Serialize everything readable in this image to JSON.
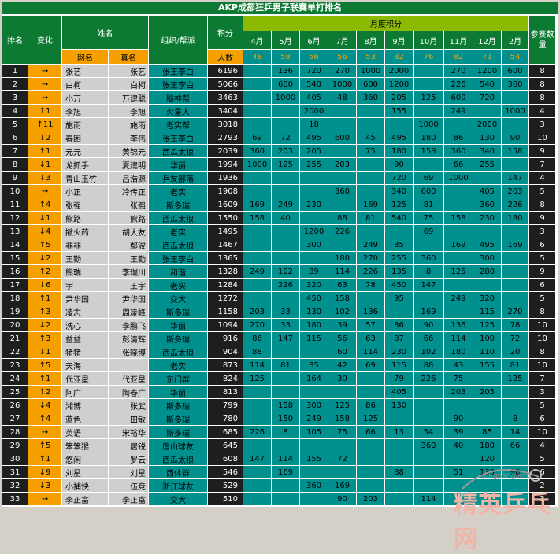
{
  "title": "AKP成都狂乒男子联赛单打排名",
  "headers": {
    "rank": "排名",
    "change": "变化",
    "name": "姓名",
    "nick": "网名",
    "real": "真名",
    "club": "组织/帮派",
    "score": "积分",
    "people": "人数",
    "monthly": "月度积分",
    "entries": "参赛数量"
  },
  "months": [
    "4月",
    "5月",
    "6月",
    "7月",
    "8月",
    "9月",
    "10月",
    "11月",
    "12月",
    "2月"
  ],
  "month_counts": [
    "48",
    "58",
    "56",
    "56",
    "53",
    "82",
    "76",
    "82",
    "71",
    "54"
  ],
  "rows": [
    {
      "rank": "1",
      "change": "→",
      "nick": "张艺",
      "real": "张艺",
      "club": "张王李白",
      "score": "6196",
      "m": [
        "",
        "136",
        "720",
        "270",
        "1000",
        "2000",
        "",
        "270",
        "1200",
        "600"
      ],
      "entries": "8"
    },
    {
      "rank": "2",
      "change": "→",
      "nick": "白柯",
      "real": "白柯",
      "club": "张王李白",
      "score": "5066",
      "m": [
        "",
        "600",
        "540",
        "1000",
        "600",
        "1200",
        "",
        "226",
        "540",
        "360"
      ],
      "entries": "8"
    },
    {
      "rank": "3",
      "change": "→",
      "nick": "小万",
      "real": "万建聪",
      "club": "脑神帮",
      "score": "3463",
      "m": [
        "",
        "1000",
        "405",
        "48",
        "360",
        "205",
        "125",
        "600",
        "720",
        ""
      ],
      "entries": "8"
    },
    {
      "rank": "4",
      "change": "↑1",
      "nick": "李旭",
      "real": "李旭",
      "club": "火星人",
      "score": "3404",
      "m": [
        "",
        "",
        "2000",
        "",
        "",
        "155",
        "",
        "249",
        "",
        "1000"
      ],
      "entries": "4"
    },
    {
      "rank": "5",
      "change": "↑11",
      "nick": "施雨",
      "real": "施雨",
      "club": "老实帮",
      "score": "3018",
      "m": [
        "",
        "",
        "18",
        "",
        "",
        "",
        "1000",
        "",
        "2000",
        ""
      ],
      "entries": "3"
    },
    {
      "rank": "6",
      "change": "↓2",
      "nick": "春困",
      "real": "李伟",
      "club": "张王李白",
      "score": "2793",
      "m": [
        "69",
        "72",
        "495",
        "600",
        "45",
        "495",
        "180",
        "86",
        "130",
        "90"
      ],
      "entries": "10"
    },
    {
      "rank": "7",
      "change": "↑1",
      "nick": "元元",
      "real": "黄锦元",
      "club": "西瓜太狼",
      "score": "2039",
      "m": [
        "360",
        "203",
        "205",
        "",
        "75",
        "180",
        "158",
        "360",
        "340",
        "158"
      ],
      "entries": "9"
    },
    {
      "rank": "8",
      "change": "↓1",
      "nick": "龙抓手",
      "real": "夏建明",
      "club": "华丽",
      "score": "1994",
      "m": [
        "1000",
        "125",
        "255",
        "203",
        "",
        "90",
        "",
        "66",
        "255",
        ""
      ],
      "entries": "7"
    },
    {
      "rank": "9",
      "change": "↓3",
      "nick": "青山玉竹",
      "real": "吕浩源",
      "club": "乒友部落",
      "score": "1936",
      "m": [
        "",
        "",
        "",
        "",
        "",
        "720",
        "69",
        "1000",
        "",
        "147"
      ],
      "entries": "4"
    },
    {
      "rank": "10",
      "change": "→",
      "nick": "小正",
      "real": "冷传正",
      "club": "老实",
      "score": "1908",
      "m": [
        "",
        "",
        "",
        "360",
        "",
        "340",
        "600",
        "",
        "405",
        "203"
      ],
      "entries": "5"
    },
    {
      "rank": "11",
      "change": "↑4",
      "nick": "张强",
      "real": "张强",
      "club": "斯多瑞",
      "score": "1609",
      "m": [
        "169",
        "249",
        "230",
        "",
        "169",
        "125",
        "81",
        "",
        "360",
        "226"
      ],
      "entries": "8"
    },
    {
      "rank": "12",
      "change": "↓1",
      "nick": "熊路",
      "real": "熊路",
      "club": "西瓜太狼",
      "score": "1550",
      "m": [
        "158",
        "40",
        "",
        "88",
        "81",
        "540",
        "75",
        "158",
        "230",
        "180"
      ],
      "entries": "9"
    },
    {
      "rank": "13",
      "change": "↓4",
      "nick": "撇火药",
      "real": "胡大友",
      "club": "老实",
      "score": "1495",
      "m": [
        "",
        "",
        "1200",
        "226",
        "",
        "",
        "69",
        "",
        "",
        ""
      ],
      "entries": "3"
    },
    {
      "rank": "14",
      "change": "↑5",
      "nick": "非非",
      "real": "鄢波",
      "club": "西瓜太狼",
      "score": "1467",
      "m": [
        "",
        "",
        "300",
        "",
        "249",
        "85",
        "",
        "169",
        "495",
        "169"
      ],
      "entries": "6"
    },
    {
      "rank": "15",
      "change": "↓2",
      "nick": "王勤",
      "real": "王勤",
      "club": "张王李白",
      "score": "1365",
      "m": [
        "",
        "",
        "",
        "180",
        "270",
        "255",
        "360",
        "",
        "300",
        ""
      ],
      "entries": "5"
    },
    {
      "rank": "16",
      "change": "↑2",
      "nick": "熊瑞",
      "real": "李瑞川",
      "club": "和谐",
      "score": "1328",
      "m": [
        "249",
        "102",
        "89",
        "114",
        "226",
        "135",
        "8",
        "125",
        "280",
        ""
      ],
      "entries": "9"
    },
    {
      "rank": "17",
      "change": "↓6",
      "nick": "宇",
      "real": "王宇",
      "club": "老实",
      "score": "1284",
      "m": [
        "",
        "226",
        "320",
        "63",
        "78",
        "450",
        "147",
        "",
        "",
        ""
      ],
      "entries": "6"
    },
    {
      "rank": "18",
      "change": "↑1",
      "nick": "尹华国",
      "real": "尹华国",
      "club": "交大",
      "score": "1272",
      "m": [
        "",
        "",
        "450",
        "158",
        "",
        "95",
        "",
        "249",
        "320",
        ""
      ],
      "entries": "5"
    },
    {
      "rank": "19",
      "change": "↑3",
      "nick": "凌志",
      "real": "周凌峰",
      "club": "斯多瑞",
      "score": "1158",
      "m": [
        "203",
        "33",
        "130",
        "102",
        "136",
        "",
        "169",
        "",
        "115",
        "270"
      ],
      "entries": "8"
    },
    {
      "rank": "20",
      "change": "↓2",
      "nick": "洗心",
      "real": "李鹏飞",
      "club": "华丽",
      "score": "1094",
      "m": [
        "270",
        "33",
        "180",
        "39",
        "57",
        "86",
        "90",
        "136",
        "125",
        "78"
      ],
      "entries": "10"
    },
    {
      "rank": "21",
      "change": "↑3",
      "nick": "益益",
      "real": "彭清辉",
      "club": "斯多瑞",
      "score": "916",
      "m": [
        "86",
        "147",
        "115",
        "56",
        "63",
        "87",
        "66",
        "114",
        "100",
        "72"
      ],
      "entries": "10"
    },
    {
      "rank": "22",
      "change": "↓1",
      "nick": "猪猪",
      "real": "张晓博",
      "club": "西瓜太狼",
      "score": "904",
      "m": [
        "88",
        "",
        "",
        "60",
        "114",
        "230",
        "102",
        "180",
        "110",
        "20"
      ],
      "entries": "8"
    },
    {
      "rank": "23",
      "change": "↑5",
      "nick": "天海",
      "real": "",
      "club": "老实",
      "score": "873",
      "m": [
        "114",
        "81",
        "85",
        "42",
        "69",
        "115",
        "88",
        "43",
        "155",
        "81"
      ],
      "entries": "10"
    },
    {
      "rank": "24",
      "change": "↑1",
      "nick": "代亚星",
      "real": "代亚星",
      "club": "东门群",
      "score": "824",
      "m": [
        "125",
        "",
        "164",
        "30",
        "",
        "79",
        "226",
        "75",
        "",
        "125"
      ],
      "entries": "7"
    },
    {
      "rank": "25",
      "change": "↑2",
      "nick": "阿广",
      "real": "陶春广",
      "club": "华丽",
      "score": "813",
      "m": [
        "",
        "",
        "",
        "",
        "",
        "405",
        "",
        "203",
        "205",
        ""
      ],
      "entries": "3"
    },
    {
      "rank": "26",
      "change": "↓4",
      "nick": "湘博",
      "real": "张武",
      "club": "斯多瑞",
      "score": "799",
      "m": [
        "",
        "158",
        "300",
        "125",
        "86",
        "130",
        "",
        "",
        "",
        ""
      ],
      "entries": "5"
    },
    {
      "rank": "27",
      "change": "↑4",
      "nick": "蓝色",
      "real": "田敏",
      "club": "斯多瑞",
      "score": "780",
      "m": [
        "",
        "150",
        "249",
        "158",
        "125",
        "",
        "",
        "90",
        "",
        "8"
      ],
      "entries": "6"
    },
    {
      "rank": "28",
      "change": "→",
      "nick": "英语",
      "real": "宋裕华",
      "club": "斯多瑞",
      "score": "685",
      "m": [
        "226",
        "8",
        "105",
        "75",
        "66",
        "13",
        "54",
        "39",
        "85",
        "14"
      ],
      "entries": "10"
    },
    {
      "rank": "29",
      "change": "↑5",
      "nick": "笨笨猴",
      "real": "居锐",
      "club": "眉山球友",
      "score": "645",
      "m": [
        "",
        "",
        "",
        "",
        "",
        "",
        "360",
        "40",
        "180",
        "66"
      ],
      "entries": "4"
    },
    {
      "rank": "30",
      "change": "↑1",
      "nick": "悠闲",
      "real": "罗云",
      "club": "西瓜太狼",
      "score": "608",
      "m": [
        "147",
        "114",
        "155",
        "72",
        "",
        "",
        "",
        "",
        "120",
        ""
      ],
      "entries": "5"
    },
    {
      "rank": "31",
      "change": "↓9",
      "nick": "刘星",
      "real": "刘星",
      "club": "西体群",
      "score": "546",
      "m": [
        "",
        "169",
        "",
        "",
        "",
        "88",
        "",
        "51",
        "130",
        "90"
      ],
      "entries": "6"
    },
    {
      "rank": "32",
      "change": "↓3",
      "nick": "小捕快",
      "real": "伍竞",
      "club": "浙江球友",
      "score": "529",
      "m": [
        "",
        "",
        "360",
        "169",
        "",
        "",
        "",
        "",
        "",
        ""
      ],
      "entries": "2"
    },
    {
      "rank": "33",
      "change": "→",
      "nick": "李正富",
      "real": "李正富",
      "club": "交大",
      "score": "510",
      "m": [
        "",
        "",
        "",
        "90",
        "203",
        "",
        "114",
        "",
        "",
        ""
      ],
      "entries": "3"
    }
  ],
  "watermark": {
    "text": "精英乒乓网",
    "url": "pingpang.info"
  }
}
